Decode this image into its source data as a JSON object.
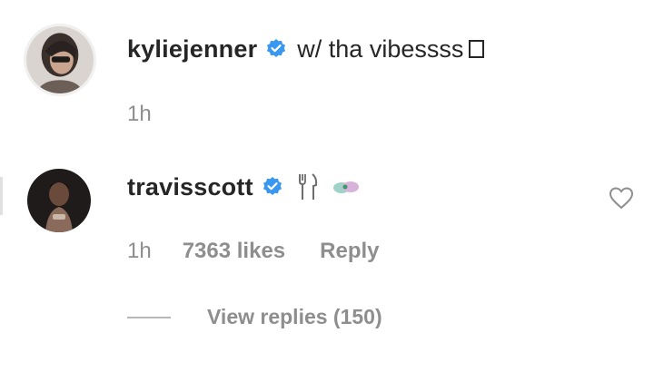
{
  "comments": [
    {
      "username": "kyliejenner",
      "verified": true,
      "text": "w/ tha vibessss",
      "time": "1h"
    },
    {
      "username": "travisscott",
      "verified": true,
      "text": "",
      "emojis": [
        "fork-and-knife-icon",
        "pill-emoji-icon"
      ],
      "time": "1h",
      "likes": "7363 likes",
      "reply_label": "Reply",
      "view_replies_label": "View replies (150)"
    }
  ],
  "colors": {
    "text_primary": "#262626",
    "text_secondary": "#8e8e8e",
    "verified_blue": "#3897f0"
  }
}
